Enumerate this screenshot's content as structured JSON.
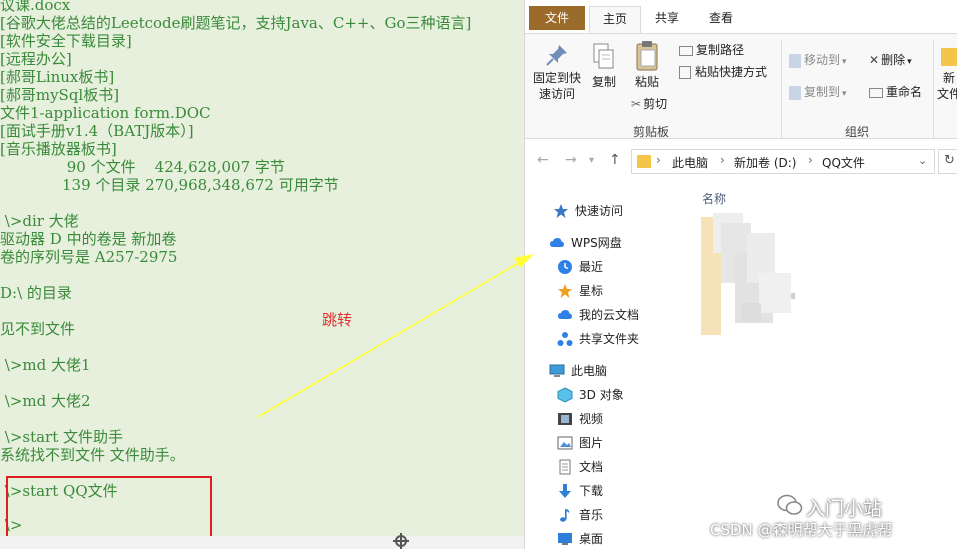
{
  "console": {
    "lines": [
      "议课.docx",
      "[谷歌大佬总结的Leetcode刷题笔记，支持Java、C++、Go三种语言]",
      "[软件安全下载目录]",
      "[远程办公]",
      "[郝哥Linux板书]",
      "[郝哥mySql板书]",
      "文件1-application form.DOC",
      "[面试手册v1.4（BATJ版本）]",
      "[音乐播放器板书]",
      "              90 个文件    424,628,007 字节",
      "             139 个目录 270,968,348,672 可用字节",
      "",
      " \\>dir 大佬",
      "驱动器 D 中的卷是 新加卷",
      "卷的序列号是 A257-2975",
      "",
      "D:\\ 的目录",
      "",
      "见不到文件",
      "",
      " \\>md 大佬1",
      "",
      " \\>md 大佬2",
      "",
      " \\>start 文件助手",
      "系统找不到文件 文件助手。",
      "",
      " \\>start QQ文件",
      "",
      " \\>"
    ]
  },
  "annotation": {
    "jump_label": "跳转"
  },
  "explorer": {
    "tabs": {
      "file": "文件",
      "home": "主页",
      "share": "共享",
      "view": "查看"
    },
    "ribbon": {
      "pin_label_1": "固定到快",
      "pin_label_2": "速访问",
      "copy": "复制",
      "paste": "粘贴",
      "copy_path": "复制路径",
      "paste_shortcut": "粘贴快捷方式",
      "cut": "剪切",
      "clipboard_group": "剪贴板",
      "move_to": "移动到",
      "copy_to": "复制到",
      "delete": "删除",
      "rename": "重命名",
      "organize_group": "组织",
      "new_1": "新",
      "new_2": "文件"
    },
    "address": {
      "crumbs": [
        "此电脑",
        "新加卷 (D:)",
        "QQ文件"
      ]
    },
    "nav": {
      "items": [
        {
          "label": "快速访问",
          "icon": "star-icon"
        },
        {
          "label": "WPS网盘",
          "icon": "cloud-icon"
        },
        {
          "label": "最近",
          "icon": "clock-icon"
        },
        {
          "label": "星标",
          "icon": "star-icon"
        },
        {
          "label": "我的云文档",
          "icon": "cloud-icon"
        },
        {
          "label": "共享文件夹",
          "icon": "share-icon"
        },
        {
          "label": "此电脑",
          "icon": "computer-icon"
        },
        {
          "label": "3D 对象",
          "icon": "cube-icon"
        },
        {
          "label": "视频",
          "icon": "video-icon"
        },
        {
          "label": "图片",
          "icon": "picture-icon"
        },
        {
          "label": "文档",
          "icon": "document-icon"
        },
        {
          "label": "下载",
          "icon": "download-icon"
        },
        {
          "label": "音乐",
          "icon": "music-icon"
        },
        {
          "label": "桌面",
          "icon": "desktop-icon"
        }
      ]
    },
    "content": {
      "column_name": "名称"
    }
  },
  "watermark": {
    "brand": "入门小站",
    "csdn": "CSDN @森明帮大于黑虎帮"
  },
  "colors": {
    "console_bg": "#e6f0dc",
    "console_text": "#3b8a3b",
    "highlight_box": "#e02020",
    "arrow": "#ffff33",
    "file_tab": "#9a6b2a"
  }
}
